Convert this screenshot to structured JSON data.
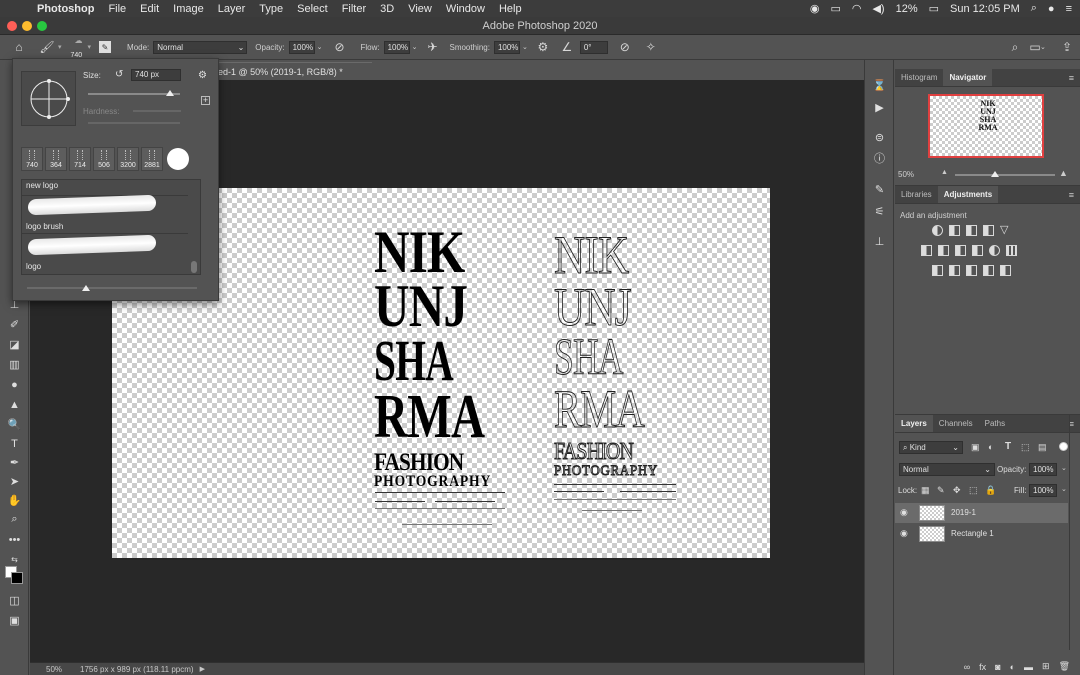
{
  "menubar": {
    "app_name": "Photoshop",
    "items": [
      "File",
      "Edit",
      "Image",
      "Layer",
      "Type",
      "Select",
      "Filter",
      "3D",
      "View",
      "Window",
      "Help"
    ],
    "battery": "12%",
    "clock": "Sun 12:05 PM"
  },
  "window": {
    "title": "Adobe Photoshop 2020"
  },
  "options_bar": {
    "brush_size": "740",
    "mode_label": "Mode:",
    "mode_value": "Normal",
    "opacity_label": "Opacity:",
    "opacity_value": "100%",
    "flow_label": "Flow:",
    "flow_value": "100%",
    "smoothing_label": "Smoothing:",
    "smoothing_value": "100%",
    "angle_value": "0°"
  },
  "document": {
    "tab_title": "ed-1 @ 50% (2019-1, RGB/8) *",
    "zoom": "50%",
    "dimensions": "1756 px x 989 px (118.11 ppcm)"
  },
  "artwork": {
    "lines": [
      "NIK",
      "UNJ",
      "SHA",
      "RMA"
    ],
    "fashion": "FASHION",
    "photography": "PHOTOGRAPHY"
  },
  "brush_popup": {
    "size_label": "Size:",
    "size_value": "740 px",
    "hardness_label": "Hardness:",
    "tips": [
      "740",
      "364",
      "714",
      "506",
      "3200",
      "2881"
    ],
    "presets": [
      "new logo",
      "logo brush",
      "logo"
    ]
  },
  "navigator": {
    "tabs": [
      "Histogram",
      "Navigator"
    ],
    "zoom": "50%",
    "thumb_lines": [
      "NIK",
      "UNJ",
      "SHA",
      "RMA"
    ]
  },
  "adjustments": {
    "tabs": [
      "Libraries",
      "Adjustments"
    ],
    "hint": "Add an adjustment"
  },
  "layers": {
    "tabs": [
      "Layers",
      "Channels",
      "Paths"
    ],
    "filter_kind": "Kind",
    "blend_mode": "Normal",
    "opacity_label": "Opacity:",
    "opacity_value": "100%",
    "lock_label": "Lock:",
    "fill_label": "Fill:",
    "fill_value": "100%",
    "items": [
      {
        "name": "2019-1",
        "selected": true
      },
      {
        "name": "Rectangle 1",
        "selected": false
      }
    ]
  },
  "colors": {
    "canvas_bg": "#282828",
    "panel_bg": "#535353",
    "accent_red": "#e04040"
  }
}
